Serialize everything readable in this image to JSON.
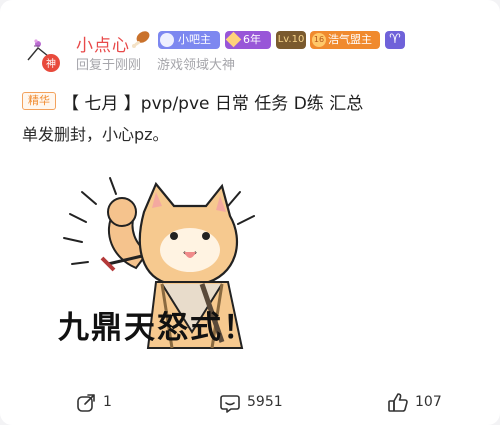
{
  "post": {
    "author": {
      "name": "小点心",
      "avatar_badge": "神",
      "badges": [
        {
          "label": "小吧主",
          "color": "#7d88f0",
          "icon": "moderator-icon"
        },
        {
          "label": "6年",
          "color": "#9856d8",
          "icon": "diamond-icon"
        },
        {
          "label": "Lv.10",
          "color": "#7a5a2e"
        },
        {
          "label": "浩气盟主",
          "color": "#f08a2e",
          "icon": "rank-16-icon",
          "icon_text": "16"
        },
        {
          "label": "♈",
          "color": "#6f62d9",
          "icon": "aries-icon"
        }
      ],
      "reply_time": "回复于刚刚",
      "forum_rank": "游戏领域大神"
    },
    "tag": "精华",
    "title": "【 七月 】pvp/pve 日常 任务 D练 汇总",
    "body": "单发删封，小心pz。",
    "sticker_caption": "九鼎天怒式！",
    "stats": {
      "shares": "1",
      "comments": "5951",
      "likes": "107"
    }
  },
  "colors": {
    "username": "#e84a4a",
    "essence_tag": "#f08a2e"
  }
}
